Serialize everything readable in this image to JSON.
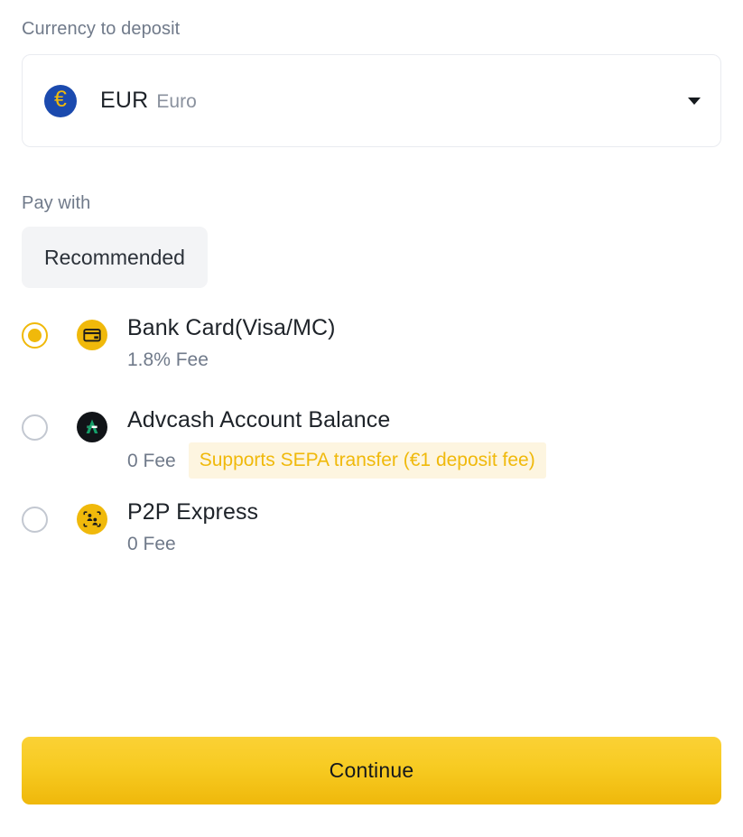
{
  "currency_field": {
    "label": "Currency to deposit",
    "selected": {
      "icon": "euro-coin-icon",
      "code": "EUR",
      "name": "Euro"
    },
    "caret_icon": "chevron-down-icon",
    "options": [
      "EUR"
    ]
  },
  "pay_with": {
    "label": "Pay with",
    "tabs": [
      {
        "label": "Recommended",
        "active": true
      }
    ],
    "methods": [
      {
        "id": "bank-card",
        "icon": "credit-card-icon",
        "title": "Bank Card(Visa/MC)",
        "fee": "1.8% Fee",
        "badge": "",
        "selected": true
      },
      {
        "id": "advcash-account-balance",
        "icon": "advcash-logo-icon",
        "title": "Advcash Account Balance",
        "fee": "0 Fee",
        "badge": "Supports SEPA transfer (€1 deposit fee)",
        "selected": false
      },
      {
        "id": "p2p-express",
        "icon": "p2p-people-icon",
        "title": "P2P Express",
        "fee": "0 Fee",
        "badge": "",
        "selected": false
      }
    ]
  },
  "footer": {
    "continue_label": "Continue"
  },
  "colors": {
    "accent": "#F0B90B",
    "badge_bg": "#FDF5E0",
    "euro_blue": "#1B4AAE",
    "muted_text": "#707A8A",
    "primary_text": "#1E2329",
    "border": "#E9EBF0",
    "tab_bg": "#F3F4F6",
    "advcash_dark": "#111418",
    "advcash_green": "#16A06A"
  }
}
